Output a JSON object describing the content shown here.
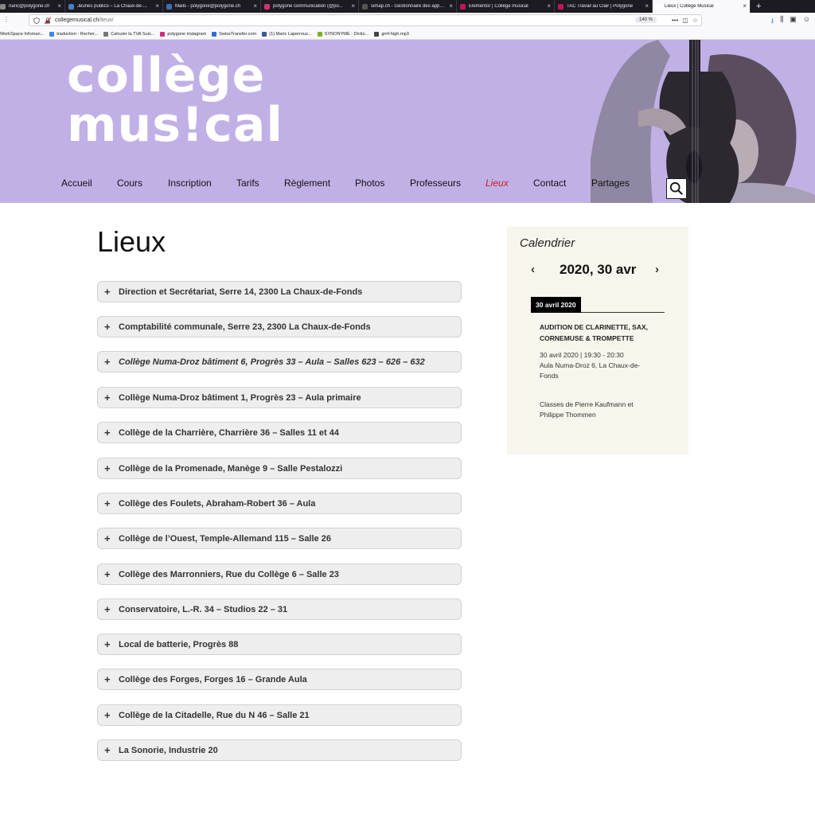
{
  "browser": {
    "tabs": [
      {
        "title": "naric@polygone.ch",
        "color": "#888888"
      },
      {
        "title": "Jeunes publics – La Chaux-de-...",
        "color": "#4a7fc1"
      },
      {
        "title": "Mails - polygone@polygone.ch",
        "color": "#3c6fb5"
      },
      {
        "title": "polygone communication (@po...",
        "color": "#d62e74"
      },
      {
        "title": "simap.ch - Gestionnaire des appels...",
        "color": "#555555"
      },
      {
        "title": "Elementor | Collège musical",
        "color": "#c3145a"
      },
      {
        "title": "TAC Travail au Clair | Polygone",
        "color": "#c3145a"
      },
      {
        "title": "Lieux | Collège Musical",
        "color": "#ffffff"
      }
    ],
    "new_tab": "+",
    "url_domain": "collegemusical.ch",
    "url_path": "/lieux/",
    "zoom": "140 %",
    "bookmarks": [
      {
        "label": "WorkSpace Infoman...",
        "color": "#666666"
      },
      {
        "label": "traduction - Recher...",
        "color": "#4285f4"
      },
      {
        "label": "Calculer la TVA Suis...",
        "color": "#777777"
      },
      {
        "label": "polygone instagram",
        "color": "#d62e74"
      },
      {
        "label": "SwissTransfer.com",
        "color": "#2d6fd6"
      },
      {
        "label": "(1) Maric Laperrouz...",
        "color": "#3b5998"
      },
      {
        "label": "SYNONYME - Dictio...",
        "color": "#7ab51d"
      },
      {
        "label": "grrif-high.mp3",
        "color": "#444444"
      }
    ]
  },
  "site": {
    "logo_line1": "collège",
    "logo_line2": "mus!cal",
    "nav": [
      "Accueil",
      "Cours",
      "Inscription",
      "Tarifs",
      "Règlement",
      "Photos",
      "Professeurs",
      "Lieux",
      "Contact",
      "Partages"
    ],
    "current_nav": "Lieux",
    "header_bg": "#c1b0e6",
    "accent_color": "#c8201c"
  },
  "page": {
    "title": "Lieux",
    "locations": [
      "Direction et Secrétariat, Serre 14, 2300 La Chaux-de-Fonds",
      "Comptabilité communale, Serre 23, 2300 La Chaux-de-Fonds",
      "Collège Numa-Droz bâtiment 6, Progrès 33 – Aula – Salles 623 – 626 – 632",
      "Collège Numa-Droz bâtiment 1, Progrès 23 – Aula primaire",
      "Collège de la Charrière, Charrière 36 – Salles 11 et 44",
      "Collège de la Promenade, Manège 9 – Salle Pestalozzi",
      "Collège des Foulets, Abraham-Robert 36 – Aula",
      "Collège de l’Ouest, Temple-Allemand 115 – Salle 26",
      "Collège des Marronniers, Rue du Collège 6 – Salle 23",
      "Conservatoire, L.-R. 34 – Studios 22 – 31",
      "Local de batterie, Progrès 88",
      "Collège des Forges, Forges 16 – Grande Aula",
      "Collège de la Citadelle, Rue du N 46 – Salle 21",
      "La Sonorie, Industrie 20"
    ]
  },
  "calendar": {
    "title": "Calendrier",
    "prev": "‹",
    "next": "›",
    "month": "2020, 30 avr",
    "date_label": "30 avril 2020",
    "event_title": "AUDITION DE CLARINETTE, SAX, CORNEMUSE & TROMPETTE",
    "event_time": "30 avril 2020 | 19:30 - 20:30",
    "event_place_1": "Aula Numa-Droz 6, La Chaux-de-",
    "event_place_2": "Fonds",
    "event_desc_1": "Classes de Pierre Kaufmann et",
    "event_desc_2": "Philippe Thommen"
  }
}
